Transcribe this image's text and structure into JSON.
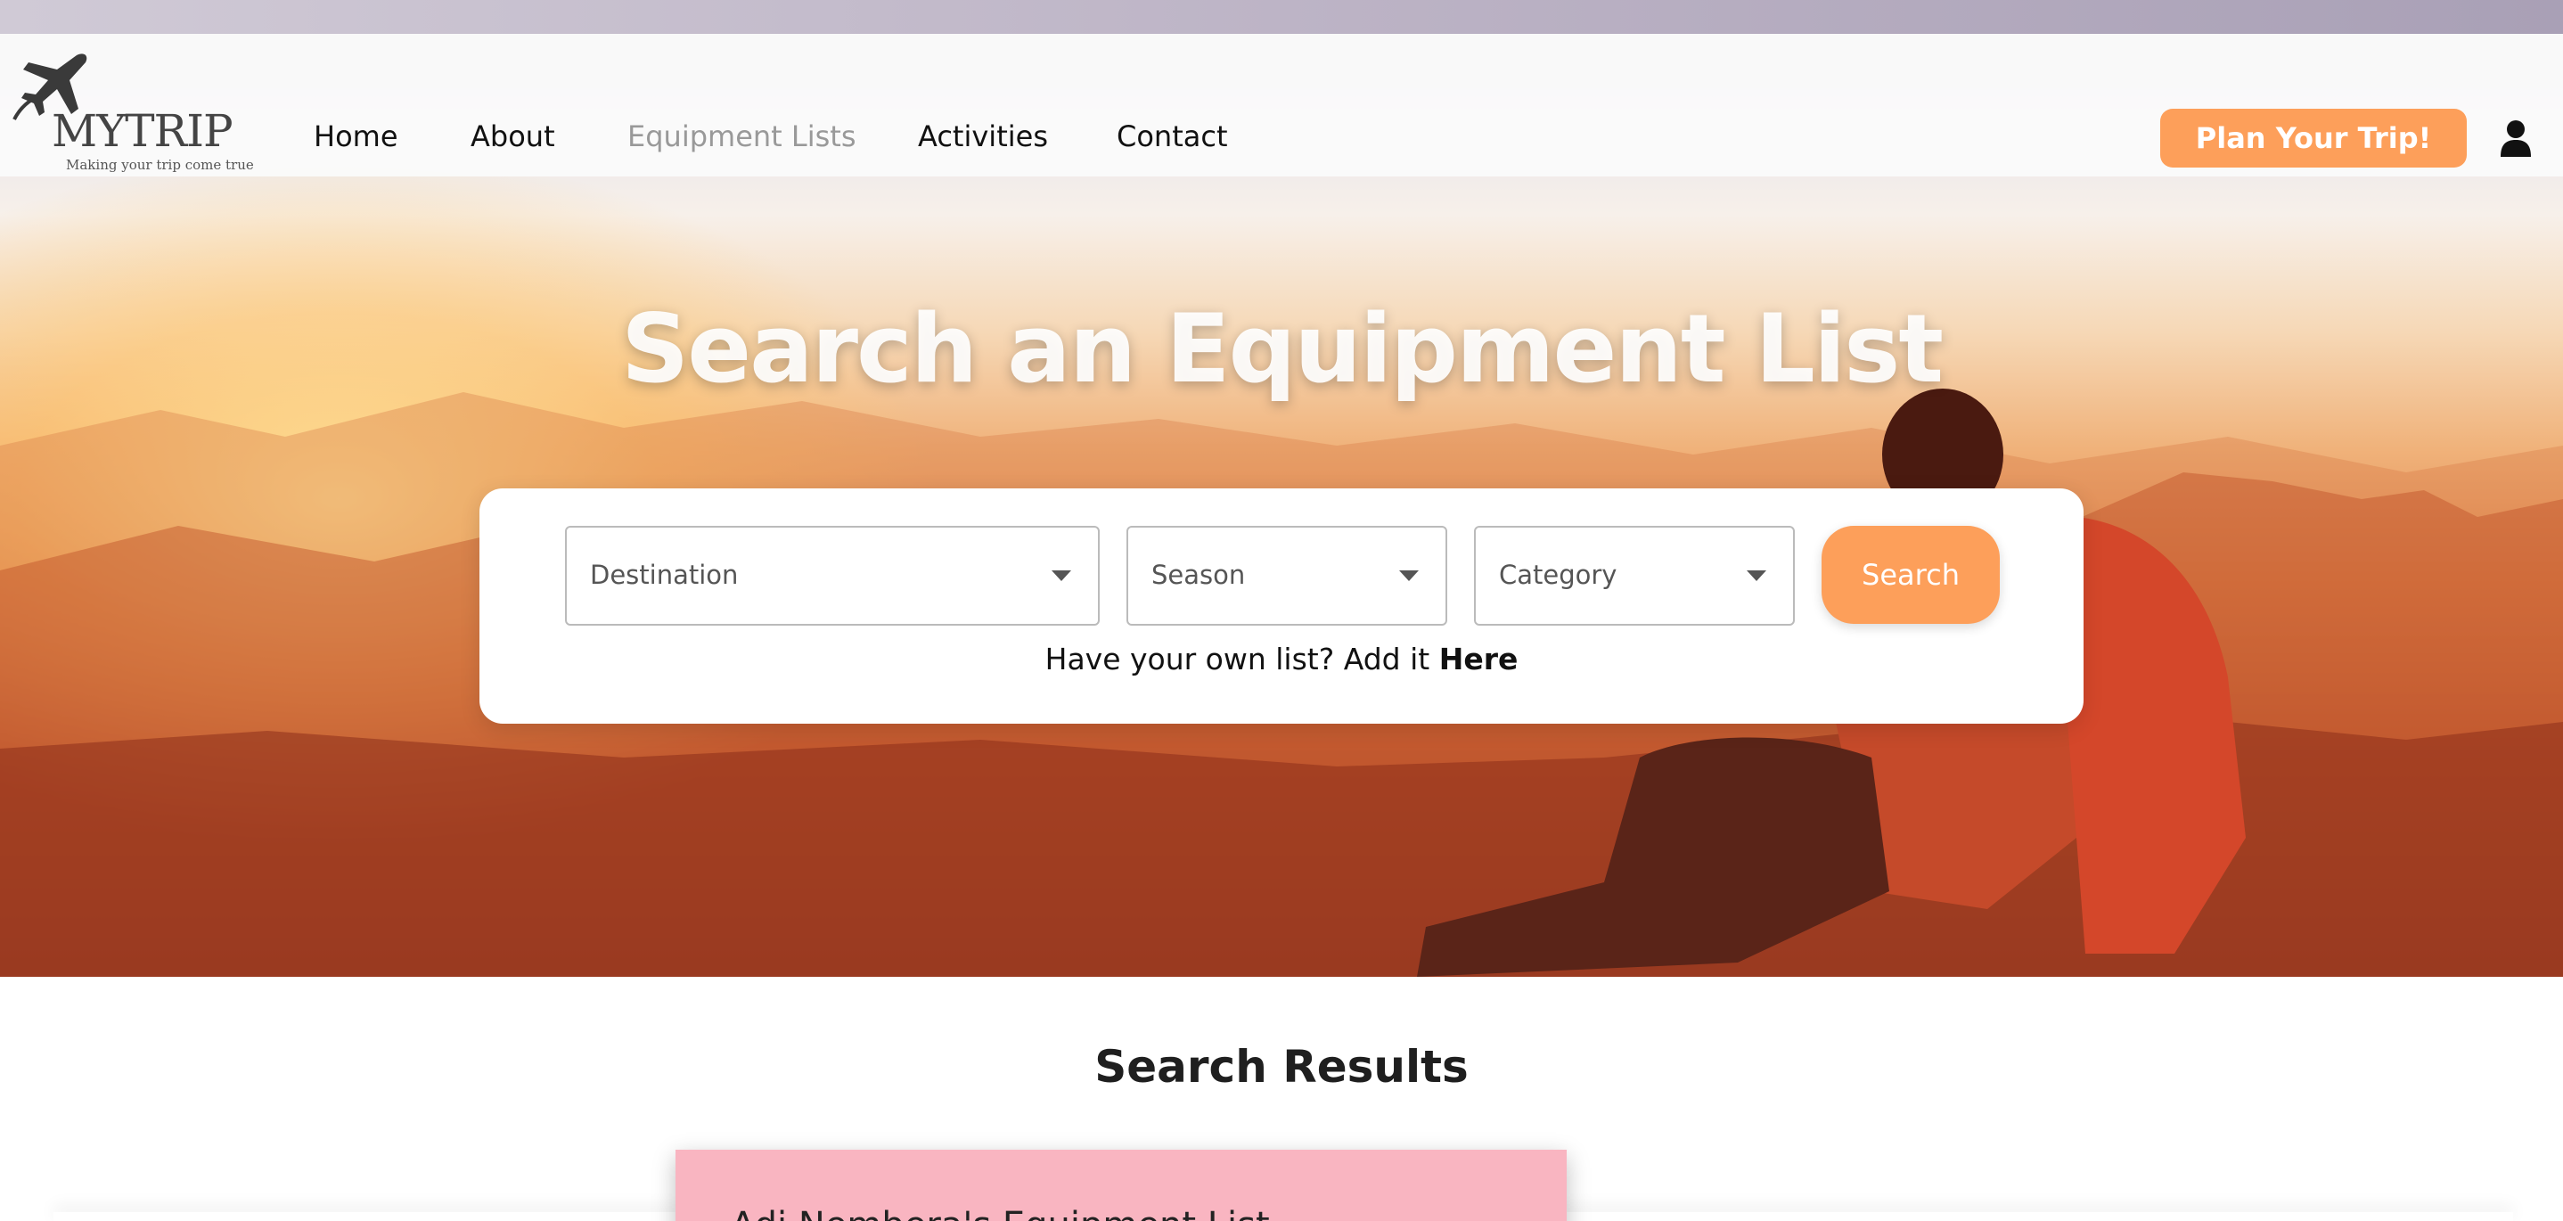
{
  "brand": {
    "name": "MYTRIP",
    "tagline": "Making your trip come true",
    "accent": "#fd9f5a"
  },
  "nav": {
    "items": [
      {
        "label": "Home"
      },
      {
        "label": "About"
      },
      {
        "label": "Equipment Lists",
        "active": true
      },
      {
        "label": "Activities"
      },
      {
        "label": "Contact"
      }
    ],
    "plan_button": "Plan Your Trip!",
    "user_icon": "user-icon"
  },
  "hero": {
    "title": "Search an Equipment List"
  },
  "search": {
    "destination_label": "Destination",
    "season_label": "Season",
    "category_label": "Category",
    "button_label": "Search",
    "add_prompt": "Have your own list? Add it ",
    "add_link": "Here"
  },
  "results": {
    "title": "Search Results",
    "items": [
      {
        "name": "Adi Nembera's Equipment List"
      }
    ]
  }
}
